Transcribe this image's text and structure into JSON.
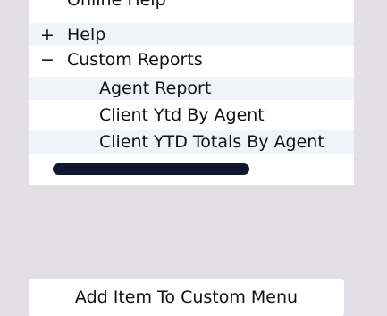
{
  "tree": {
    "items": [
      {
        "toggle": "",
        "label": "Online Help"
      },
      {
        "toggle": "+",
        "label": "Help"
      },
      {
        "toggle": "−",
        "label": "Custom Reports"
      },
      {
        "toggle": "",
        "label": "Agent Report"
      },
      {
        "toggle": "",
        "label": "Client Ytd By Agent"
      },
      {
        "toggle": "",
        "label": "Client YTD Totals By Agent"
      }
    ]
  },
  "actions": {
    "add_item_label": "Add Item To Custom Menu"
  }
}
